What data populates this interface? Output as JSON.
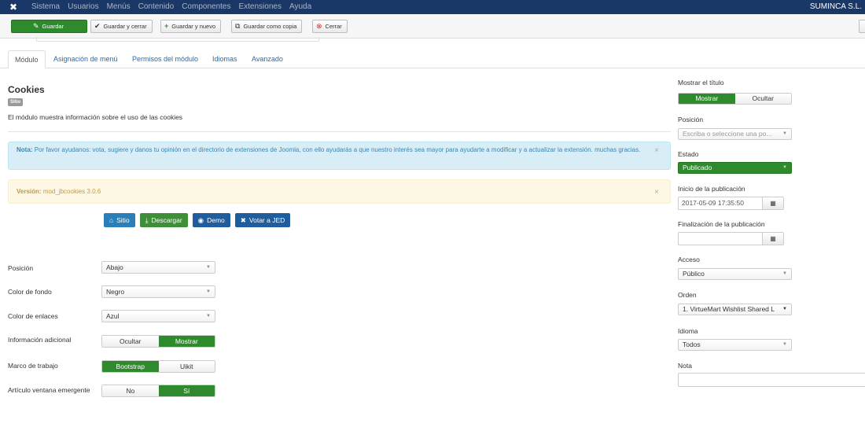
{
  "topbar": {
    "menu": [
      "Sistema",
      "Usuarios",
      "Menús",
      "Contenido",
      "Componentes",
      "Extensiones",
      "Ayuda"
    ],
    "site_name": "SUMINCA S.L."
  },
  "toolbar": {
    "save": "Guardar",
    "save_close": "Guardar y cerrar",
    "save_new": "Guardar y nuevo",
    "save_copy": "Guardar como copia",
    "close": "Cerrar"
  },
  "tabs": [
    "Módulo",
    "Asignación de menú",
    "Permisos del módulo",
    "Idiomas",
    "Avanzado"
  ],
  "module": {
    "title": "Cookies",
    "badge": "Sitio",
    "description": "El módulo muestra información sobre el uso de las cookies"
  },
  "alerts": {
    "info_label": "Nota:",
    "info_text": "Por favor ayudanos: vota, sugiere y danos tu opinión en el directorio de extensiones de Joomla, con ello ayudarás a que nuestro interés sea mayor para ayudarte a modificar y a actualizar la extensión. muchas gracias.",
    "version_label": "Versión:",
    "version_text": "mod_jbcookies 3.0.6",
    "close_glyph": "×"
  },
  "link_buttons": {
    "site": "Sitio",
    "download": "Descargar",
    "demo": "Demo",
    "vote": "Votar a JED"
  },
  "fields": {
    "position": {
      "label": "Posición",
      "value": "Abajo"
    },
    "bg_color": {
      "label": "Color de fondo",
      "value": "Negro"
    },
    "link_color": {
      "label": "Color de enlaces",
      "value": "Azul"
    },
    "extra_info": {
      "label": "Información adicional",
      "off": "Ocultar",
      "on": "Mostrar",
      "selected": "on"
    },
    "framework": {
      "label": "Marco de trabajo",
      "a": "Bootstrap",
      "b": "Uikit",
      "selected": "a"
    },
    "popup": {
      "label": "Artículo ventana emergente",
      "off": "No",
      "on": "Sí",
      "selected": "on"
    }
  },
  "sidebar": {
    "show_title": {
      "label": "Mostrar el título",
      "on": "Mostrar",
      "off": "Ocultar",
      "selected": "on"
    },
    "position": {
      "label": "Posición",
      "placeholder": "Escriba o seleccione una po..."
    },
    "status": {
      "label": "Estado",
      "value": "Publicado"
    },
    "publish_up": {
      "label": "Inicio de la publicación",
      "value": "2017-05-09 17:35:50"
    },
    "publish_down": {
      "label": "Finalización de la publicación",
      "value": ""
    },
    "access": {
      "label": "Acceso",
      "value": "Público"
    },
    "ordering": {
      "label": "Orden",
      "value": "1. VirtueMart Wishlist Shared L"
    },
    "language": {
      "label": "Idioma",
      "value": "Todos"
    },
    "note": {
      "label": "Nota",
      "value": ""
    }
  },
  "colors": {
    "navbar": "#1a3867",
    "green": "#2f8a2d",
    "info_bg": "#d9edf7",
    "warn_bg": "#fcf8e3"
  }
}
